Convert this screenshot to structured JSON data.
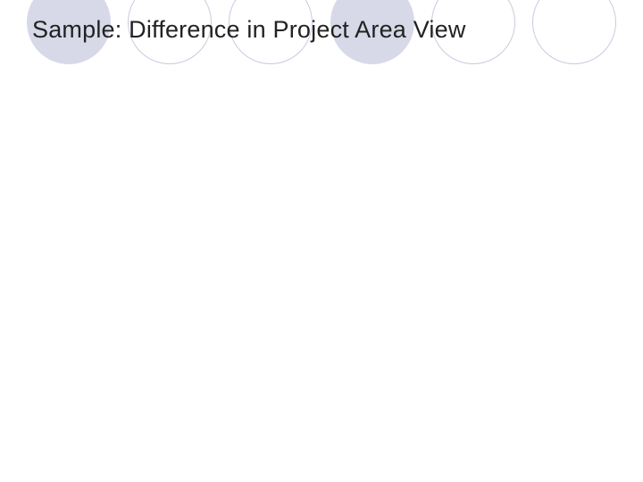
{
  "slide": {
    "title": "Sample: Difference in Project Area View"
  },
  "decoration": {
    "circles": [
      {
        "type": "filled"
      },
      {
        "type": "outline"
      },
      {
        "type": "outline"
      },
      {
        "type": "filled"
      },
      {
        "type": "outline"
      },
      {
        "type": "outline"
      }
    ]
  }
}
